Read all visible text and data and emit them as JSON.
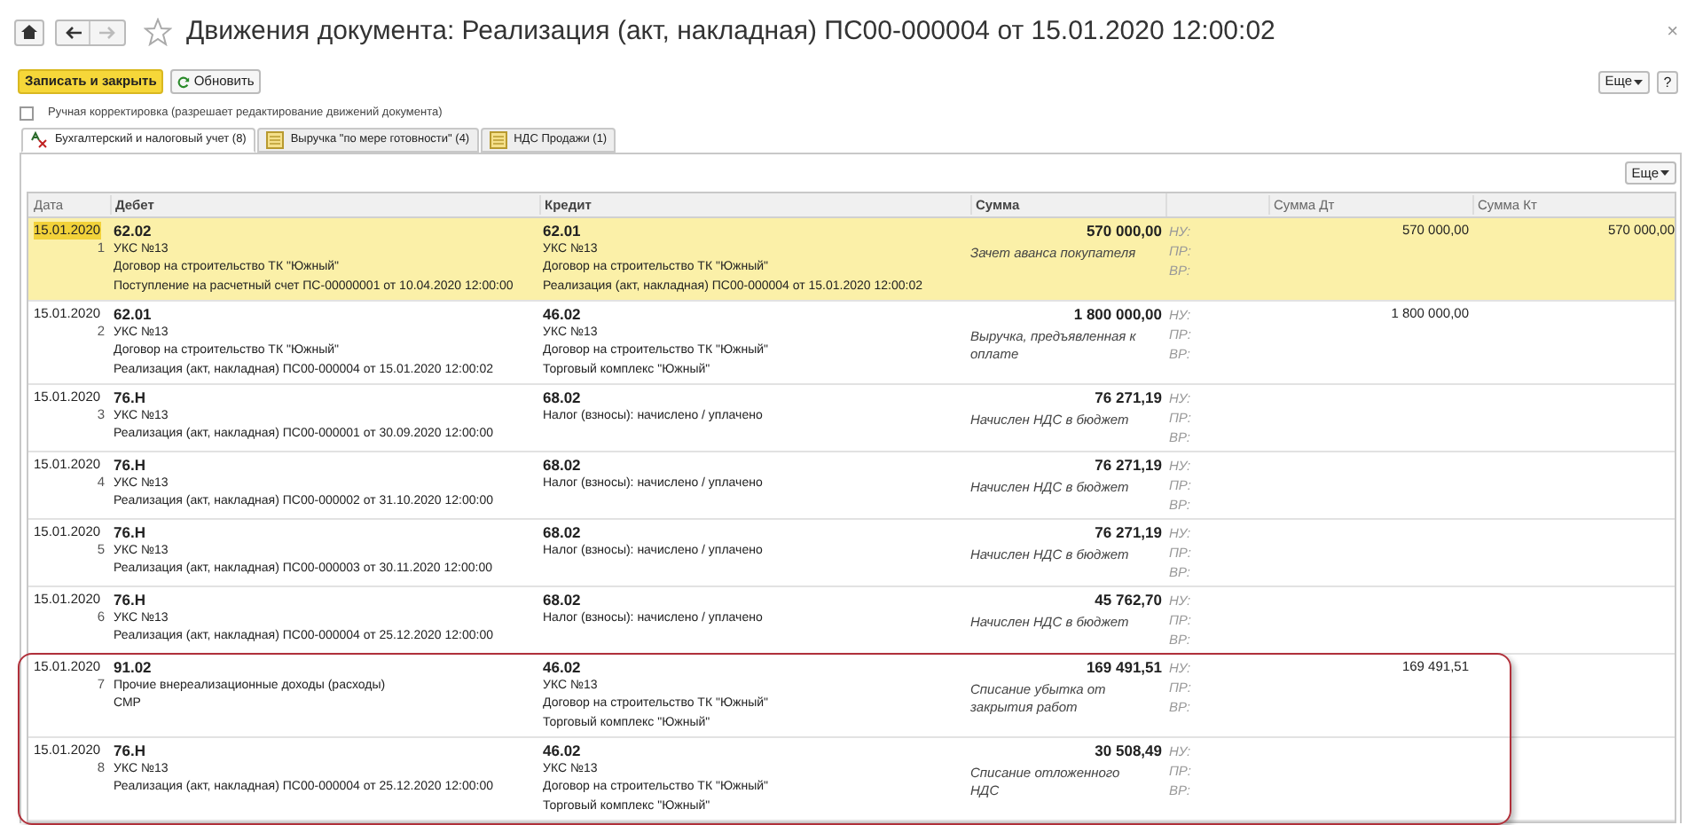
{
  "window": {
    "title": "Движения документа: Реализация (акт, накладная) ПС00-000004 от 15.01.2020 12:00:02",
    "close": "×"
  },
  "toolbar": {
    "save_close": "Записать и закрыть",
    "refresh": "Обновить",
    "more": "Еще",
    "help": "?"
  },
  "manual_edit": {
    "label": "Ручная корректировка (разрешает редактирование движений документа)",
    "checked": false
  },
  "tabs": [
    {
      "label": "Бухгалтерский и налоговый учет (8)",
      "selected": true,
      "kind": "ledger"
    },
    {
      "label": "Выручка \"по мере готовности\" (4)",
      "selected": false,
      "kind": "register"
    },
    {
      "label": "НДС Продажи (1)",
      "selected": false,
      "kind": "register"
    }
  ],
  "table_more": "Еще",
  "table": {
    "columns": [
      "Дата",
      "Дебет",
      "Кредит",
      "Сумма",
      "Сумма Дт",
      "Сумма Кт"
    ],
    "rows": [
      {
        "date": "15.01.2020",
        "number": "1",
        "selected": true,
        "circled": false,
        "debit": {
          "account": "62.02",
          "lines": [
            "УКС №13",
            "Договор на строительство ТК \"Южный\"",
            "Поступление на расчетный счет ПС-00000001 от 10.04.2020 12:00:00"
          ]
        },
        "credit": {
          "account": "62.01",
          "lines": [
            "УКС №13",
            "Договор на строительство ТК \"Южный\"",
            "Реализация (акт, накладная) ПС00-000004 от 15.01.2020 12:00:02"
          ]
        },
        "sum": "570 000,00",
        "note": "Зачет аванса покупателя",
        "tax_labels": [
          "НУ:",
          "ПР:",
          "ВР:"
        ],
        "sum_dt": "570 000,00",
        "sum_kt": "570 000,00"
      },
      {
        "date": "15.01.2020",
        "number": "2",
        "selected": false,
        "circled": false,
        "debit": {
          "account": "62.01",
          "lines": [
            "УКС №13",
            "Договор на строительство ТК \"Южный\"",
            "Реализация (акт, накладная) ПС00-000004 от 15.01.2020 12:00:02"
          ]
        },
        "credit": {
          "account": "46.02",
          "lines": [
            "УКС №13",
            "Договор на строительство ТК \"Южный\"",
            "Торговый комплекс \"Южный\""
          ]
        },
        "sum": "1 800 000,00",
        "note": "Выручка, предъявленная к оплате",
        "tax_labels": [
          "НУ:",
          "ПР:",
          "ВР:"
        ],
        "sum_dt": "1 800 000,00"
      },
      {
        "date": "15.01.2020",
        "number": "3",
        "selected": false,
        "circled": false,
        "debit": {
          "account": "76.Н",
          "lines": [
            "УКС №13",
            "Реализация (акт, накладная) ПС00-000001 от 30.09.2020 12:00:00"
          ]
        },
        "credit": {
          "account": "68.02",
          "lines": [
            "Налог (взносы): начислено / уплачено"
          ]
        },
        "sum": "76 271,19",
        "note": "Начислен НДС в бюджет",
        "tax_labels": [
          "НУ:",
          "ПР:",
          "ВР:"
        ]
      },
      {
        "date": "15.01.2020",
        "number": "4",
        "selected": false,
        "circled": false,
        "debit": {
          "account": "76.Н",
          "lines": [
            "УКС №13",
            "Реализация (акт, накладная) ПС00-000002 от 31.10.2020 12:00:00"
          ]
        },
        "credit": {
          "account": "68.02",
          "lines": [
            "Налог (взносы): начислено / уплачено"
          ]
        },
        "sum": "76 271,19",
        "note": "Начислен НДС в бюджет",
        "tax_labels": [
          "НУ:",
          "ПР:",
          "ВР:"
        ]
      },
      {
        "date": "15.01.2020",
        "number": "5",
        "selected": false,
        "circled": false,
        "debit": {
          "account": "76.Н",
          "lines": [
            "УКС №13",
            "Реализация (акт, накладная) ПС00-000003 от 30.11.2020 12:00:00"
          ]
        },
        "credit": {
          "account": "68.02",
          "lines": [
            "Налог (взносы): начислено / уплачено"
          ]
        },
        "sum": "76 271,19",
        "note": "Начислен НДС в бюджет",
        "tax_labels": [
          "НУ:",
          "ПР:",
          "ВР:"
        ]
      },
      {
        "date": "15.01.2020",
        "number": "6",
        "selected": false,
        "circled": false,
        "debit": {
          "account": "76.Н",
          "lines": [
            "УКС №13",
            "Реализация (акт, накладная) ПС00-000004 от 25.12.2020 12:00:00"
          ]
        },
        "credit": {
          "account": "68.02",
          "lines": [
            "Налог (взносы): начислено / уплачено"
          ]
        },
        "sum": "45 762,70",
        "note": "Начислен НДС в бюджет",
        "tax_labels": [
          "НУ:",
          "ПР:",
          "ВР:"
        ]
      },
      {
        "date": "15.01.2020",
        "number": "7",
        "selected": false,
        "circled": true,
        "debit": {
          "account": "91.02",
          "lines": [
            "Прочие внереализационные доходы (расходы)",
            "СМР"
          ]
        },
        "credit": {
          "account": "46.02",
          "lines": [
            "УКС №13",
            "Договор на строительство ТК \"Южный\"",
            "Торговый комплекс \"Южный\""
          ]
        },
        "sum": "169 491,51",
        "note": "Списание убытка от закрытия работ",
        "tax_labels": [
          "НУ:",
          "ПР:",
          "ВР:"
        ],
        "sum_dt": "169 491,51"
      },
      {
        "date": "15.01.2020",
        "number": "8",
        "selected": false,
        "circled": true,
        "debit": {
          "account": "76.Н",
          "lines": [
            "УКС №13",
            "Реализация (акт, накладная) ПС00-000004 от 25.12.2020 12:00:00"
          ]
        },
        "credit": {
          "account": "46.02",
          "lines": [
            "УКС №13",
            "Договор на строительство ТК \"Южный\"",
            "Торговый комплекс \"Южный\""
          ]
        },
        "sum": "30 508,49",
        "note": "Списание отложенного НДС",
        "tax_labels": [
          "НУ:",
          "ПР:",
          "ВР:"
        ]
      }
    ]
  }
}
